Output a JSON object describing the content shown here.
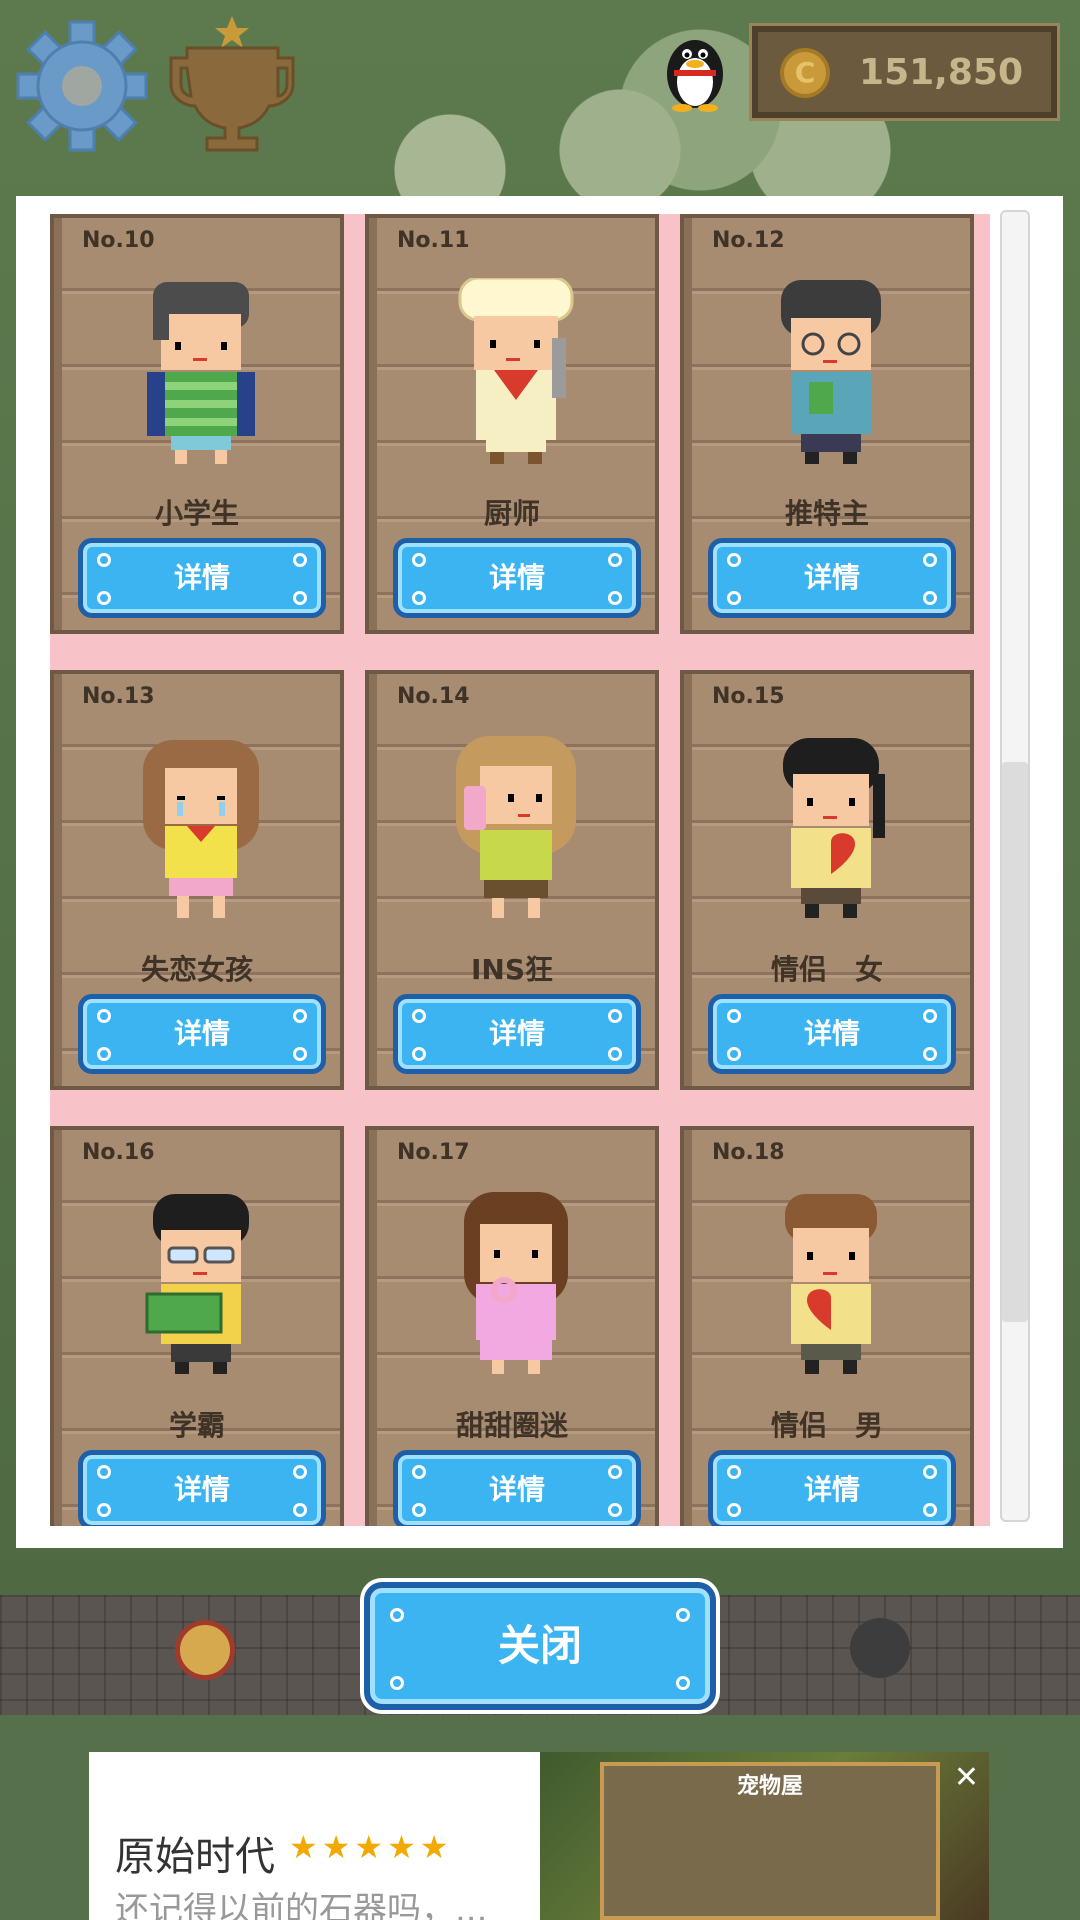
{
  "header": {
    "coin_amount": "151,850",
    "coin_symbol": "C"
  },
  "cards": [
    {
      "number": "No.10",
      "name": "小学生",
      "detail_label": "详情"
    },
    {
      "number": "No.11",
      "name": "厨师",
      "detail_label": "详情"
    },
    {
      "number": "No.12",
      "name": "推特主",
      "detail_label": "详情"
    },
    {
      "number": "No.13",
      "name": "失恋女孩",
      "detail_label": "详情"
    },
    {
      "number": "No.14",
      "name": "INS狂",
      "detail_label": "详情"
    },
    {
      "number": "No.15",
      "name": "情侣　女",
      "detail_label": "详情"
    },
    {
      "number": "No.16",
      "name": "学霸",
      "detail_label": "详情"
    },
    {
      "number": "No.17",
      "name": "甜甜圈迷",
      "detail_label": "详情"
    },
    {
      "number": "No.18",
      "name": "情侣　男",
      "detail_label": "详情"
    }
  ],
  "close_label": "关闭",
  "ad": {
    "title": "原始时代",
    "stars": "★★★★★",
    "description": "还记得以前的石器吗，...",
    "image_heading": "宠物屋",
    "close": "✕"
  },
  "icons": {
    "settings": "gear-icon",
    "achievements": "trophy-icon",
    "qq": "penguin-icon",
    "coin": "coin-icon"
  },
  "colors": {
    "button_fill": "#3db4f2",
    "button_border": "#1e5fa8",
    "grid_bg": "#f8c3c8",
    "card_wood": "#a78c72"
  }
}
